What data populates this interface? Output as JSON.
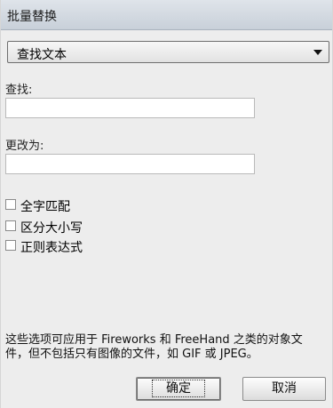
{
  "window": {
    "title": "批量替换"
  },
  "dropdown": {
    "selected": "查找文本"
  },
  "find": {
    "label": "查找:",
    "value": ""
  },
  "replace": {
    "label": "更改为:",
    "value": ""
  },
  "options": [
    {
      "label": "全字匹配",
      "checked": false
    },
    {
      "label": "区分大小写",
      "checked": false
    },
    {
      "label": "正则表达式",
      "checked": false
    }
  ],
  "note": "这些选项可应用于 Fireworks 和 FreeHand 之类的对象文件，但不包括只有图像的文件，如 GIF 或 JPEG。",
  "buttons": {
    "ok": "确定",
    "cancel": "取消"
  },
  "colors": {
    "titlebar": "#cfd6de",
    "panel": "#ededed"
  },
  "icons": {
    "dropdown": "chevron-down-icon",
    "checkbox": "checkbox-icon"
  }
}
